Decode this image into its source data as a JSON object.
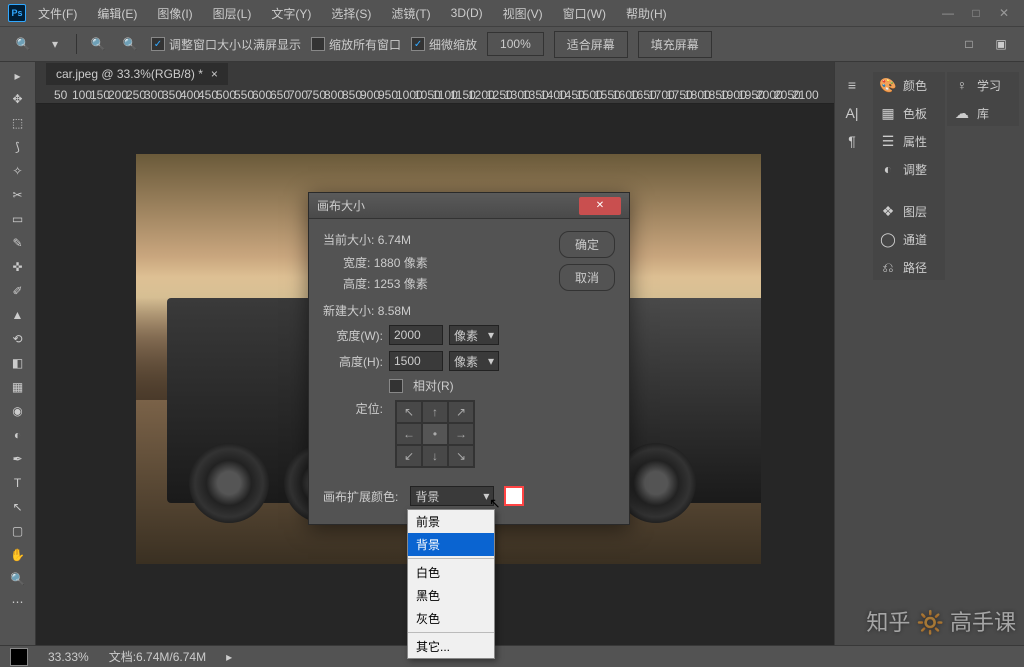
{
  "menu": {
    "file": "文件(F)",
    "edit": "编辑(E)",
    "image": "图像(I)",
    "layer": "图层(L)",
    "type": "文字(Y)",
    "select": "选择(S)",
    "filter": "滤镜(T)",
    "d3d": "3D(D)",
    "view": "视图(V)",
    "window": "窗口(W)",
    "help": "帮助(H)"
  },
  "options": {
    "fit_window": "调整窗口大小以满屏显示",
    "zoom_all": "缩放所有窗口",
    "scrubby": "细微缩放",
    "zoom_100": "100%",
    "fit_screen": "适合屏幕",
    "fill_screen": "填充屏幕"
  },
  "doc": {
    "tab": "car.jpeg @ 33.3%(RGB/8) *"
  },
  "ruler": [
    "50",
    "100",
    "150",
    "200",
    "250",
    "300",
    "350",
    "400",
    "450",
    "500",
    "550",
    "600",
    "650",
    "700",
    "750",
    "800",
    "850",
    "900",
    "950",
    "1000",
    "1050",
    "1100",
    "1150",
    "1200",
    "1250",
    "1300",
    "1350",
    "1400",
    "1450",
    "1500",
    "1550",
    "1600",
    "1650",
    "1700",
    "1750",
    "1800",
    "1850",
    "1900",
    "1950",
    "2000",
    "2050",
    "2100"
  ],
  "dialog": {
    "title": "画布大小",
    "current_size_label": "当前大小:",
    "current_size": "6.74M",
    "width_label": "宽度:",
    "width_val": "1880 像素",
    "height_label": "高度:",
    "height_val": "1253 像素",
    "new_size_label": "新建大小:",
    "new_size": "8.58M",
    "w_label": "宽度(W):",
    "w_val": "2000",
    "h_label": "高度(H):",
    "h_val": "1500",
    "unit": "像素",
    "relative": "相对(R)",
    "anchor": "定位:",
    "ext_color": "画布扩展颜色:",
    "ext_sel": "背景",
    "ok": "确定",
    "cancel": "取消"
  },
  "dropdown": {
    "foreground": "前景",
    "background": "背景",
    "white": "白色",
    "black": "黑色",
    "gray": "灰色",
    "other": "其它..."
  },
  "panels": {
    "color": "颜色",
    "swatches": "色板",
    "properties": "属性",
    "adjustments": "调整",
    "layers": "图层",
    "channels": "通道",
    "paths": "路径",
    "learn": "学习",
    "libraries": "库"
  },
  "status": {
    "zoom": "33.33%",
    "doc": "文档:6.74M/6.74M"
  },
  "watermark": "知乎 🔆 高手课"
}
